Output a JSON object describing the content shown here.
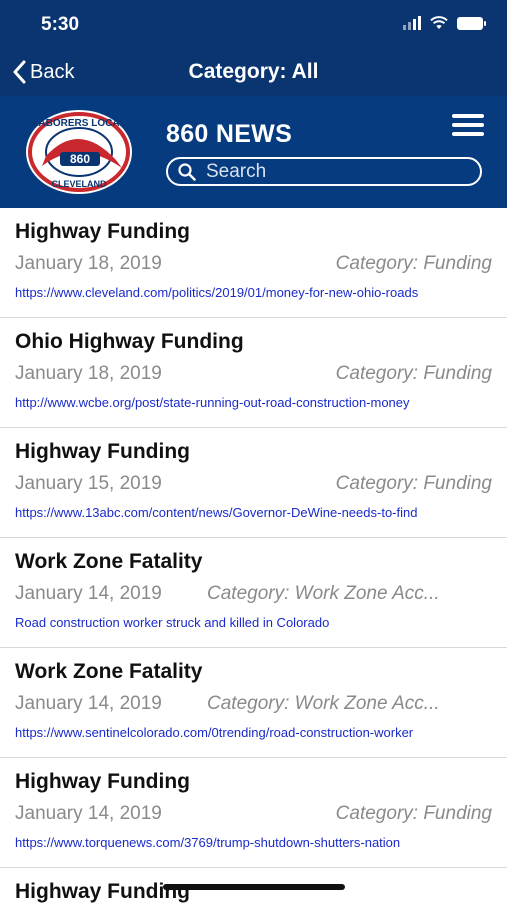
{
  "status_bar": {
    "time": "5:30",
    "icons": [
      "signal-icon",
      "wifi-icon",
      "battery-icon"
    ]
  },
  "nav_bar": {
    "back_label": "Back",
    "title": "Category: All"
  },
  "brand": {
    "app_title": "860 NEWS",
    "logo": {
      "top_text": "LABORERS LOCAL",
      "number": "860",
      "bottom_text": "CLEVELAND"
    }
  },
  "search": {
    "placeholder": "Search",
    "value": ""
  },
  "articles": [
    {
      "title": "Highway Funding",
      "date": "January 18, 2019",
      "category": "Category:  Funding",
      "link": "https://www.cleveland.com/politics/2019/01/money-for-new-ohio-roads"
    },
    {
      "title": "Ohio Highway Funding",
      "date": "January 18, 2019",
      "category": "Category:  Funding",
      "link": "http://www.wcbe.org/post/state-running-out-road-construction-money"
    },
    {
      "title": "Highway Funding",
      "date": "January 15, 2019",
      "category": "Category:  Funding",
      "link": "https://www.13abc.com/content/news/Governor-DeWine-needs-to-find"
    },
    {
      "title": "Work Zone Fatality",
      "date": "January 14, 2019",
      "category": "Category:  Work Zone Acc...",
      "link": "Road construction worker struck and killed in Colorado"
    },
    {
      "title": "Work Zone Fatality",
      "date": "January 14, 2019",
      "category": "Category:  Work Zone Acc...",
      "link": "https://www.sentinelcolorado.com/0trending/road-construction-worker"
    },
    {
      "title": "Highway Funding",
      "date": "January 14, 2019",
      "category": "Category:  Funding",
      "link": "https://www.torquenews.com/3769/trump-shutdown-shutters-nation"
    }
  ],
  "partial_item": {
    "title": "Highway Funding"
  },
  "colors": {
    "header": "#0a3570",
    "brand_bar": "#073b80",
    "link": "#1a2bc9",
    "muted": "#8a8a8a"
  }
}
